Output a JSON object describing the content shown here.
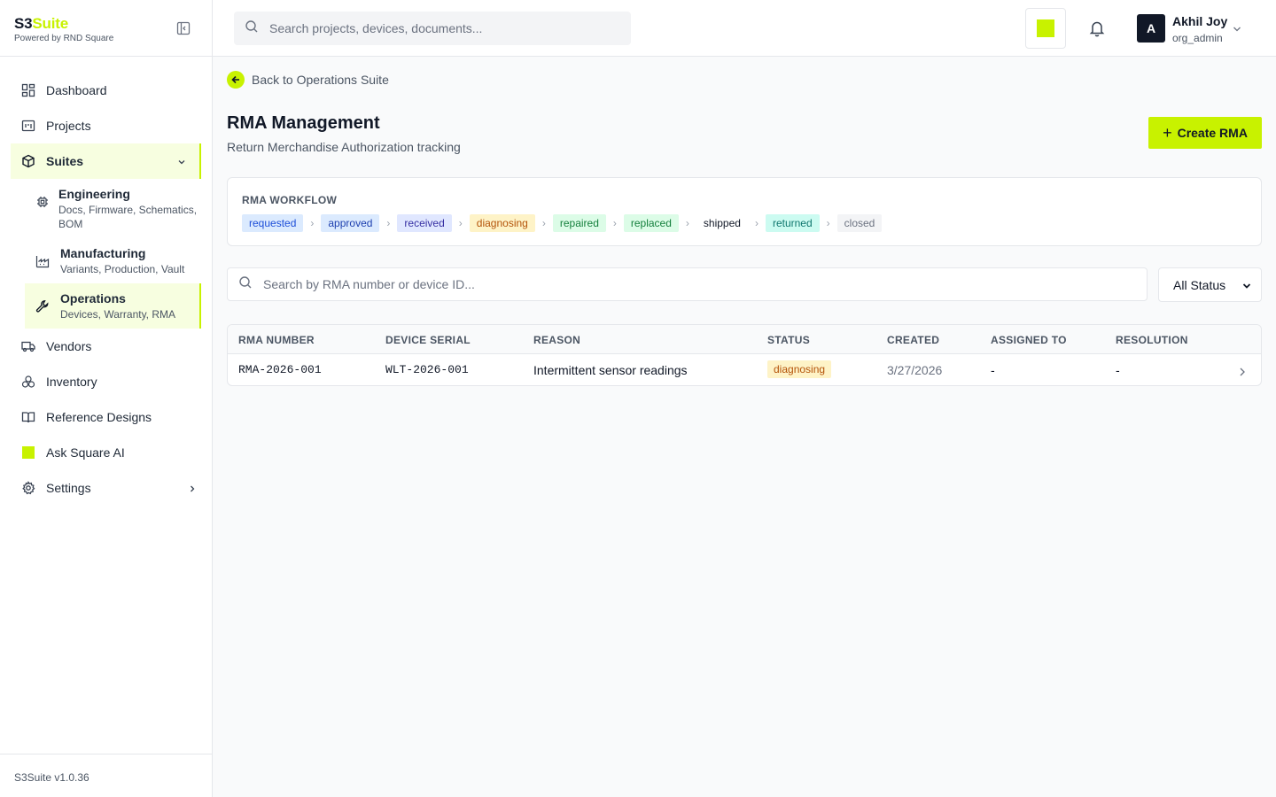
{
  "brand": {
    "name_part1": "S3",
    "name_part2": "Suite",
    "subtitle": "Powered by RND Square"
  },
  "sidebar": {
    "items": [
      {
        "label": "Dashboard"
      },
      {
        "label": "Projects"
      },
      {
        "label": "Suites"
      },
      {
        "label": "Vendors"
      },
      {
        "label": "Inventory"
      },
      {
        "label": "Reference Designs"
      },
      {
        "label": "Ask Square AI"
      },
      {
        "label": "Settings"
      }
    ],
    "suites": [
      {
        "title": "Engineering",
        "desc": "Docs, Firmware, Schematics, BOM"
      },
      {
        "title": "Manufacturing",
        "desc": "Variants, Production, Vault"
      },
      {
        "title": "Operations",
        "desc": "Devices, Warranty, RMA"
      }
    ],
    "version": "S3Suite v1.0.36"
  },
  "topbar": {
    "search_placeholder": "Search projects, devices, documents...",
    "user": {
      "initial": "A",
      "name": "Akhil Joy",
      "role": "org_admin"
    }
  },
  "main": {
    "back_label": "Back to Operations Suite",
    "title": "RMA Management",
    "subtitle": "Return Merchandise Authorization tracking",
    "create_label": "Create RMA",
    "workflow": {
      "label": "RMA WORKFLOW",
      "steps": [
        {
          "label": "requested",
          "bg": "#dbeafe",
          "color": "#1d4ed8"
        },
        {
          "label": "approved",
          "bg": "#dbeafe",
          "color": "#1e40af"
        },
        {
          "label": "received",
          "bg": "#e0e7ff",
          "color": "#3730a3"
        },
        {
          "label": "diagnosing",
          "bg": "#fef3c7",
          "color": "#b45309"
        },
        {
          "label": "repaired",
          "bg": "#dcfce7",
          "color": "#15803d"
        },
        {
          "label": "replaced",
          "bg": "#dcfce7",
          "color": "#15803d"
        },
        {
          "label": "shipped",
          "bg": "#ffffff",
          "color": "#111827"
        },
        {
          "label": "returned",
          "bg": "#ccfbf1",
          "color": "#0f766e"
        },
        {
          "label": "closed",
          "bg": "#f3f4f6",
          "color": "#6b7280"
        }
      ]
    },
    "filter": {
      "search_placeholder": "Search by RMA number or device ID...",
      "status_value": "All Status"
    },
    "table": {
      "headers": [
        "RMA NUMBER",
        "DEVICE SERIAL",
        "REASON",
        "STATUS",
        "CREATED",
        "ASSIGNED TO",
        "RESOLUTION"
      ],
      "rows": [
        {
          "rma": "RMA-2026-001",
          "serial": "WLT-2026-001",
          "reason": "Intermittent sensor readings",
          "status": "diagnosing",
          "created": "3/27/2026",
          "assigned": "-",
          "resolution": "-"
        }
      ]
    }
  },
  "colors": {
    "accent": "#c8f200",
    "dark": "#111827"
  }
}
